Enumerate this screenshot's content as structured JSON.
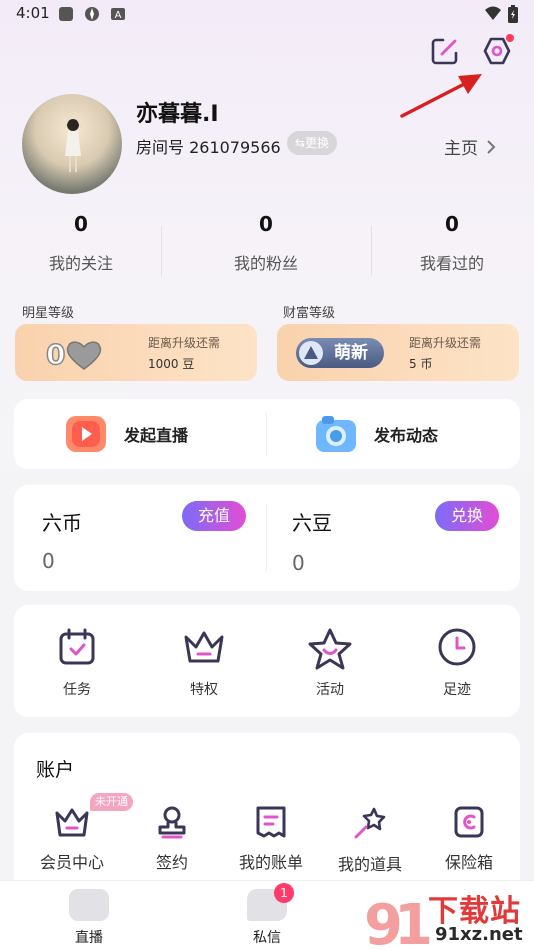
{
  "status_bar": {
    "time": "4:01",
    "app_icons": [
      "square-icon",
      "pinwheel-icon",
      "a-badge-icon"
    ],
    "right_icons": [
      "wifi-icon",
      "battery-icon"
    ]
  },
  "header": {
    "icons": [
      "edit-icon",
      "settings-icon"
    ]
  },
  "profile": {
    "username": "亦暮暮.I",
    "room_label": "房间号 261079566",
    "change_label": "⇆更换",
    "home_label": "主页"
  },
  "stats": [
    {
      "value": "0",
      "label": "我的关注"
    },
    {
      "value": "0",
      "label": "我的粉丝"
    },
    {
      "value": "0",
      "label": "我看过的"
    }
  ],
  "levels": {
    "star": {
      "title": "明星等级",
      "level": "0",
      "sub": "距离升级还需",
      "value": "1000 豆"
    },
    "wealth": {
      "title": "财富等级",
      "badge": "萌新",
      "sub": "距离升级还需",
      "value": "5 币"
    }
  },
  "actions": [
    {
      "label": "发起直播",
      "icon": "play-icon"
    },
    {
      "label": "发布动态",
      "icon": "camera-icon"
    }
  ],
  "wallet": [
    {
      "title": "六币",
      "value": "0",
      "button": "充值"
    },
    {
      "title": "六豆",
      "value": "0",
      "button": "兑换"
    }
  ],
  "shortcuts": [
    {
      "label": "任务",
      "icon": "calendar-icon"
    },
    {
      "label": "特权",
      "icon": "crown-icon"
    },
    {
      "label": "活动",
      "icon": "star-icon"
    },
    {
      "label": "足迹",
      "icon": "clock-icon"
    }
  ],
  "account": {
    "title": "账户",
    "not_open_badge": "未开通",
    "items": [
      {
        "label": "会员中心",
        "icon": "crown-icon"
      },
      {
        "label": "签约",
        "icon": "stamp-icon"
      },
      {
        "label": "我的账单",
        "icon": "receipt-icon"
      },
      {
        "label": "我的道具",
        "icon": "magic-wand-icon"
      },
      {
        "label": "保险箱",
        "icon": "safe-icon"
      }
    ]
  },
  "tabbar": {
    "items": [
      {
        "label": "直播"
      },
      {
        "label": "私信",
        "badge": "1"
      }
    ]
  },
  "watermark": {
    "text_big": "下载站",
    "text_small": "91xz.net"
  },
  "colors": {
    "accent_gradient_start": "#7b6cf6",
    "accent_gradient_end": "#e34dd4",
    "icon_purple": "#3b3558",
    "icon_pink": "#e055c8"
  }
}
